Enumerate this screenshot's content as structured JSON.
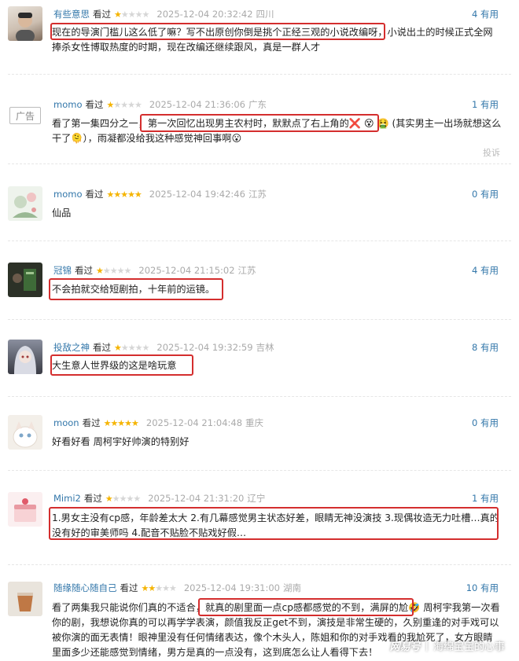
{
  "reviews": [
    {
      "user": "有些意思",
      "watched": "看过",
      "rating": 1,
      "time": "2025-12-04 20:32:42",
      "location": "四川",
      "useful": "4 有用",
      "text": "现在的导演门槛儿这么低了嘛？写不出原创你倒是挑个正经三观的小说改编呀，小说出土的时候正式全网捧杀女性博取热度的时期，现在改编还继续跟风，真是一群人才"
    },
    {
      "user": "momo",
      "watched": "看过",
      "rating": 1,
      "time": "2025-12-04 21:36:06",
      "location": "广东",
      "useful": "1 有用",
      "text": "看了第一集四分之一，第一次回忆出现男主农村时，默默点了右上角的❌ 😵 🤮 (其实男主一出场就想这么干了🫠），雨凝都没给我这种感觉神回事啊😮",
      "ad_label": "广告",
      "report": "投诉"
    },
    {
      "user": "momo",
      "watched": "看过",
      "rating": 5,
      "time": "2025-12-04 19:42:46",
      "location": "江苏",
      "useful": "0 有用",
      "text": "仙品"
    },
    {
      "user": "冠锦",
      "watched": "看过",
      "rating": 1,
      "time": "2025-12-04 21:15:02",
      "location": "江苏",
      "useful": "4 有用",
      "text": "不会拍就交给短剧拍，十年前的运镜。"
    },
    {
      "user": "投敌之神",
      "watched": "看过",
      "rating": 1,
      "time": "2025-12-04 19:32:59",
      "location": "吉林",
      "useful": "8 有用",
      "text": "大生意人世界级的这是啥玩意"
    },
    {
      "user": "moon",
      "watched": "看过",
      "rating": 5,
      "time": "2025-12-04 21:04:48",
      "location": "重庆",
      "useful": "0 有用",
      "text": "好看好看 周柯宇好帅演的特别好"
    },
    {
      "user": "Mimi2",
      "watched": "看过",
      "rating": 1,
      "time": "2025-12-04 21:31:20",
      "location": "辽宁",
      "useful": "1 有用",
      "text": "1.男女主没有cp感，年龄差太大 2.有几幕感觉男主状态好差，眼睛无神没演技 3.现偶妆造无力吐槽…真的没有好的审美师吗 4.配音不贴脸不贴戏好假…"
    },
    {
      "user": "随缘随心随自己",
      "watched": "看过",
      "rating": 2,
      "time": "2025-12-04 19:31:00",
      "location": "湖南",
      "useful": "10 有用",
      "text": "看了两集我只能说你们真的不适合，就真的剧里面一点cp感都感觉的不到，满屏的尬🤣 周柯宇我第一次看你的剧，我想说你真的可以再学学表演，颜值我反正get不到，演技是非常生硬的，久别重逢的对手戏可以被你演的面无表情！眼神里没有任何情绪表达，像个木头人，陈姐和你的对手戏看的我尬死了，女方眼睛里面多少还能感觉到情绪，男方是真的一点没有，这到底怎么让人看得下去！"
    }
  ],
  "watermark": {
    "logo": "网易号",
    "separator": "|",
    "account": "海绵宝宝的心事"
  },
  "colors": {
    "link": "#3377aa",
    "star": "#f5b400",
    "highlight": "#d42e2e",
    "muted": "#aaaaaa"
  }
}
